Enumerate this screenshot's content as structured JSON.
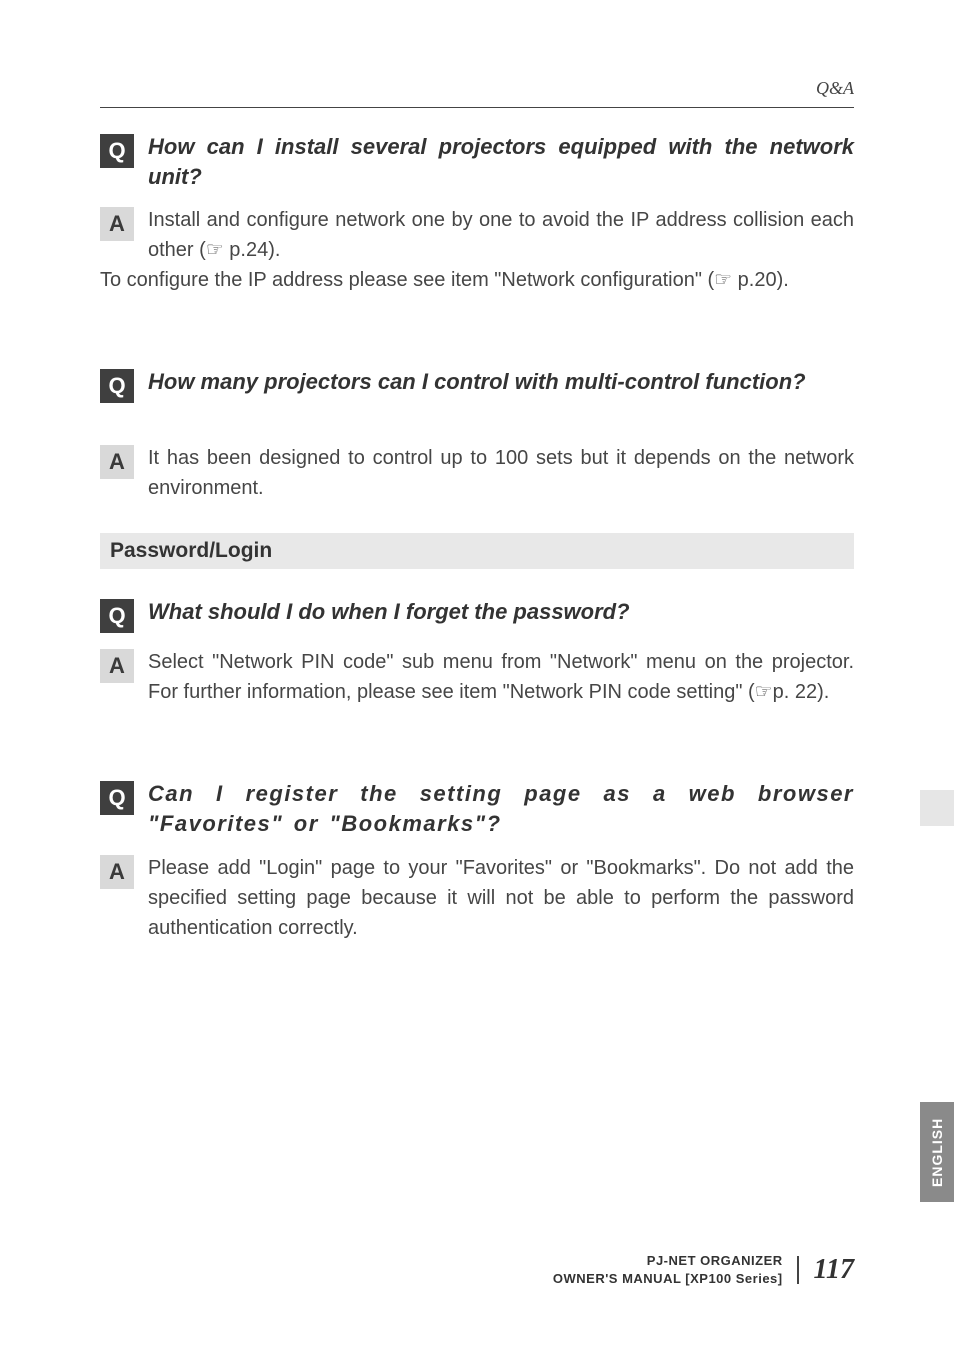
{
  "header": {
    "running": "Q&A"
  },
  "qa": [
    {
      "q": "How can I install several projectors equipped with the network unit?",
      "a1_pre": "Install and configure network one by one to avoid the IP address collision each other (",
      "a1_ref": "☞ p.24",
      "a1_post": ").",
      "a2_pre": "To configure the IP address please see item \"Network configuration\" (",
      "a2_ref": "☞ p.20",
      "a2_post": ")."
    },
    {
      "q": "How many projectors can I control with multi-control function?",
      "a": "It has been designed to control up to 100 sets but it depends on the network environment."
    }
  ],
  "section": "Password/Login",
  "qa2": [
    {
      "q": "What should I do when I forget the password?",
      "a_pre": "Select \"Network PIN code\" sub menu from \"Network\" menu on the projector. For further information, please see item \"Network PIN code setting\" (",
      "a_ref": "☞p. 22",
      "a_post": ")."
    },
    {
      "q": "Can I register the setting page as a web browser \"Favorites\" or \"Bookmarks\"?",
      "a": "Please add \"Login\" page to your \"Favorites\" or \"Bookmarks\". Do not add the specified setting page because it will not be able to perform the password authentication correctly."
    }
  ],
  "badges": {
    "q": "Q",
    "a": "A"
  },
  "footer": {
    "line1": "PJ-NET ORGANIZER",
    "line2": "OWNER'S MANUAL [XP100 Series]",
    "page": "117"
  },
  "sidetab": "ENGLISH"
}
